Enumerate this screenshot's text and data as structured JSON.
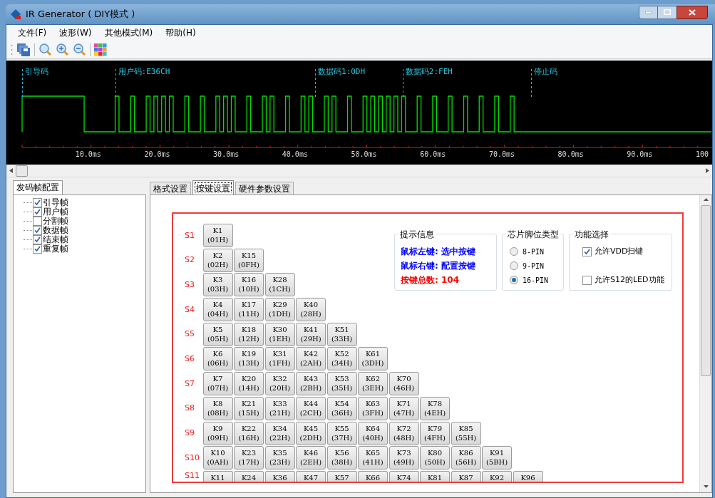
{
  "window": {
    "title": "IR Generator ( DIY模式 )"
  },
  "menu": [
    "文件(F)",
    "波形(W)",
    "其他模式(M)",
    "帮助(H)"
  ],
  "waveform": {
    "markers": [
      "引导码",
      "用户码:E36CH",
      "数据码1:0DH",
      "数据码2:FEH",
      "停止码"
    ],
    "ticks": [
      "10.0ms",
      "20.0ms",
      "30.0ms",
      "40.0ms",
      "50.0ms",
      "60.0ms",
      "70.0ms",
      "80.0ms",
      "90.0ms",
      "100"
    ]
  },
  "left_panel": {
    "tab": "发码帧配置",
    "items": [
      {
        "label": "引导帧",
        "checked": true
      },
      {
        "label": "用户帧",
        "checked": true
      },
      {
        "label": "分割帧",
        "checked": false
      },
      {
        "label": "数据帧",
        "checked": true
      },
      {
        "label": "结束帧",
        "checked": true
      },
      {
        "label": "重复帧",
        "checked": true
      }
    ]
  },
  "tabs": [
    {
      "label": "格式设置",
      "selected": false
    },
    {
      "label": "按键设置",
      "selected": true
    },
    {
      "label": "硬件参数设置",
      "selected": false
    }
  ],
  "info": {
    "title": "提示信息",
    "lines": [
      {
        "text": "鼠标左键: 选中按键",
        "color": "#0000ff"
      },
      {
        "text": "鼠标右键: 配置按键",
        "color": "#0000ff"
      },
      {
        "text": "按键总数: 104",
        "color": "#ff0000"
      }
    ]
  },
  "pin_type": {
    "title": "芯片脚位类型",
    "options": [
      {
        "label": "8-PIN",
        "selected": false
      },
      {
        "label": "9-PIN",
        "selected": false
      },
      {
        "label": "16-PIN",
        "selected": true
      }
    ]
  },
  "functions": {
    "title": "功能选择",
    "options": [
      {
        "label": "允许VDD扫键",
        "checked": true
      },
      {
        "label": "允许S12的LED功能",
        "checked": false
      }
    ]
  },
  "key_rows": [
    {
      "label": "S1",
      "keys": [
        {
          "name": "K1",
          "code": "(01H)"
        }
      ]
    },
    {
      "label": "S2",
      "keys": [
        {
          "name": "K2",
          "code": "(02H)"
        },
        {
          "name": "K15",
          "code": "(0FH)"
        }
      ]
    },
    {
      "label": "S3",
      "keys": [
        {
          "name": "K3",
          "code": "(03H)"
        },
        {
          "name": "K16",
          "code": "(10H)"
        },
        {
          "name": "K28",
          "code": "(1CH)"
        }
      ]
    },
    {
      "label": "S4",
      "keys": [
        {
          "name": "K4",
          "code": "(04H)"
        },
        {
          "name": "K17",
          "code": "(11H)"
        },
        {
          "name": "K29",
          "code": "(1DH)"
        },
        {
          "name": "K40",
          "code": "(28H)"
        }
      ]
    },
    {
      "label": "S5",
      "keys": [
        {
          "name": "K5",
          "code": "(05H)"
        },
        {
          "name": "K18",
          "code": "(12H)"
        },
        {
          "name": "K30",
          "code": "(1EH)"
        },
        {
          "name": "K41",
          "code": "(29H)"
        },
        {
          "name": "K51",
          "code": "(33H)"
        }
      ]
    },
    {
      "label": "S6",
      "keys": [
        {
          "name": "K6",
          "code": "(06H)"
        },
        {
          "name": "K19",
          "code": "(13H)"
        },
        {
          "name": "K31",
          "code": "(1FH)"
        },
        {
          "name": "K42",
          "code": "(2AH)"
        },
        {
          "name": "K52",
          "code": "(34H)"
        },
        {
          "name": "K61",
          "code": "(3DH)"
        }
      ]
    },
    {
      "label": "S7",
      "keys": [
        {
          "name": "K7",
          "code": "(07H)"
        },
        {
          "name": "K20",
          "code": "(14H)"
        },
        {
          "name": "K32",
          "code": "(20H)"
        },
        {
          "name": "K43",
          "code": "(2BH)"
        },
        {
          "name": "K53",
          "code": "(35H)"
        },
        {
          "name": "K62",
          "code": "(3EH)"
        },
        {
          "name": "K70",
          "code": "(46H)"
        }
      ]
    },
    {
      "label": "S8",
      "keys": [
        {
          "name": "K8",
          "code": "(08H)"
        },
        {
          "name": "K21",
          "code": "(15H)"
        },
        {
          "name": "K33",
          "code": "(21H)"
        },
        {
          "name": "K44",
          "code": "(2CH)"
        },
        {
          "name": "K54",
          "code": "(36H)"
        },
        {
          "name": "K63",
          "code": "(3FH)"
        },
        {
          "name": "K71",
          "code": "(47H)"
        },
        {
          "name": "K78",
          "code": "(4EH)"
        }
      ]
    },
    {
      "label": "S9",
      "keys": [
        {
          "name": "K9",
          "code": "(09H)"
        },
        {
          "name": "K22",
          "code": "(16H)"
        },
        {
          "name": "K34",
          "code": "(22H)"
        },
        {
          "name": "K45",
          "code": "(2DH)"
        },
        {
          "name": "K55",
          "code": "(37H)"
        },
        {
          "name": "K64",
          "code": "(40H)"
        },
        {
          "name": "K72",
          "code": "(48H)"
        },
        {
          "name": "K79",
          "code": "(4FH)"
        },
        {
          "name": "K85",
          "code": "(55H)"
        }
      ]
    },
    {
      "label": "S10",
      "keys": [
        {
          "name": "K10",
          "code": "(0AH)"
        },
        {
          "name": "K23",
          "code": "(17H)"
        },
        {
          "name": "K35",
          "code": "(23H)"
        },
        {
          "name": "K46",
          "code": "(2EH)"
        },
        {
          "name": "K56",
          "code": "(38H)"
        },
        {
          "name": "K65",
          "code": "(41H)"
        },
        {
          "name": "K73",
          "code": "(49H)"
        },
        {
          "name": "K80",
          "code": "(50H)"
        },
        {
          "name": "K86",
          "code": "(56H)"
        },
        {
          "name": "K91",
          "code": "(5BH)"
        }
      ]
    },
    {
      "label": "S11",
      "keys": [
        {
          "name": "K11"
        },
        {
          "name": "K24"
        },
        {
          "name": "K36"
        },
        {
          "name": "K47"
        },
        {
          "name": "K57"
        },
        {
          "name": "K66"
        },
        {
          "name": "K74"
        },
        {
          "name": "K81"
        },
        {
          "name": "K87"
        },
        {
          "name": "K92"
        },
        {
          "name": "K96"
        }
      ]
    }
  ]
}
